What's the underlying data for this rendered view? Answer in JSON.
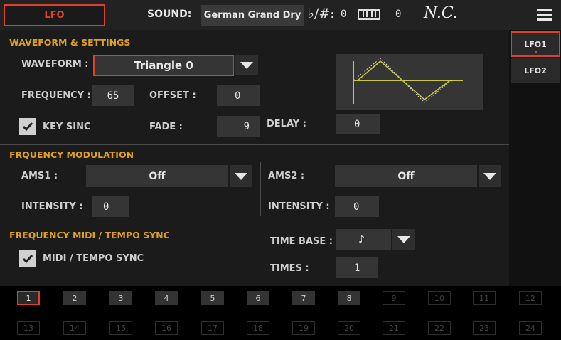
{
  "topbar": {
    "lfo_tab": "LFO",
    "sound_label": "SOUND:",
    "sound_value": "German Grand Dry",
    "flat_sharp": "♭/#:",
    "transpose": "0",
    "octave": "0",
    "chord": "N.C."
  },
  "waveform_section": {
    "title": "WAVEFORM & SETTINGS",
    "waveform_label": "WAVEFORM :",
    "waveform_value": "Triangle 0",
    "frequency_label": "FREQUENCY :",
    "frequency_value": "65",
    "offset_label": "OFFSET :",
    "offset_value": "0",
    "key_sinc_label": "KEY SINC",
    "key_sinc_checked": true,
    "fade_label": "FADE :",
    "fade_value": "9",
    "delay_label": "DELAY :",
    "delay_value": "0"
  },
  "freq_mod": {
    "title": "FRQUENCY MODULATION",
    "ams1_label": "AMS1 :",
    "ams1_value": "Off",
    "ams2_label": "AMS2 :",
    "ams2_value": "Off",
    "intensity1_label": "INTENSITY :",
    "intensity1_value": "0",
    "intensity2_label": "INTENSITY :",
    "intensity2_value": "0"
  },
  "midi_sync": {
    "title": "FREQUENCY MIDI / TEMPO SYNC",
    "midi_tempo_label": "MIDI / TEMPO SYNC",
    "midi_tempo_checked": true,
    "time_base_label": "TIME BASE :",
    "time_base_value": "♪",
    "times_label": "TIMES :",
    "times_value": "1"
  },
  "right_tabs": [
    "LFO1",
    "LFO2"
  ],
  "pager": {
    "row1": [
      "1",
      "2",
      "3",
      "4",
      "5",
      "6",
      "7",
      "8",
      "9",
      "10",
      "11",
      "12"
    ],
    "row2": [
      "13",
      "14",
      "15",
      "16",
      "17",
      "18",
      "19",
      "20",
      "21",
      "22",
      "23",
      "24"
    ],
    "selected": "1",
    "enabled_count": 8
  },
  "colors": {
    "accent_red": "#e0402a",
    "section_title": "#e0a020",
    "waveform_line": "#c8c840"
  }
}
